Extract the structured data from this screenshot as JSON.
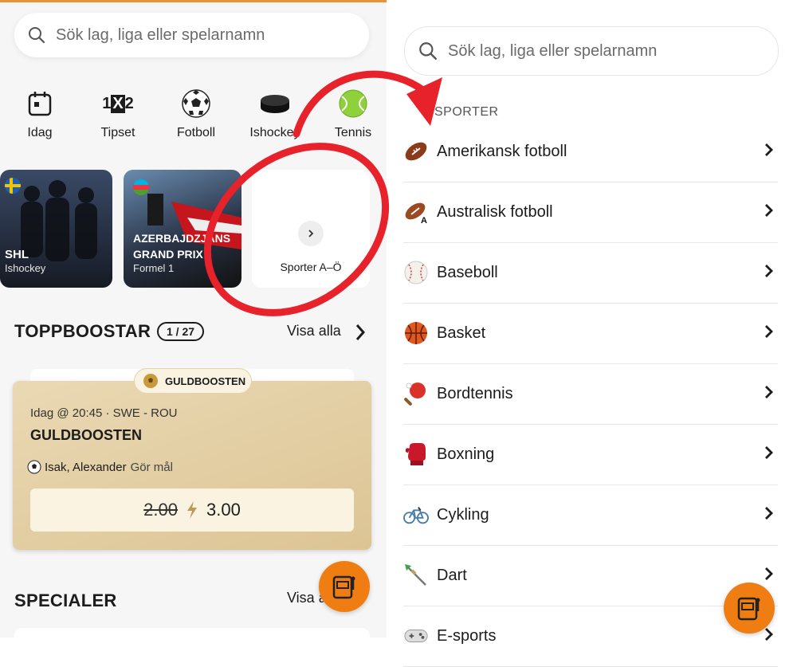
{
  "left": {
    "search_placeholder": "Sök lag, liga eller spelarnamn",
    "quick": [
      {
        "label": "Idag",
        "icon": "calendar-icon"
      },
      {
        "label": "Tipset",
        "icon": "1x2-icon"
      },
      {
        "label": "Fotboll",
        "icon": "soccer-ball-icon"
      },
      {
        "label": "Ishockey",
        "icon": "hockey-puck-icon"
      },
      {
        "label": "Tennis",
        "icon": "tennis-ball-icon"
      }
    ],
    "cards": [
      {
        "title": "SHL",
        "subtitle": "Ishockey",
        "flag": "sweden-flag-icon"
      },
      {
        "title": "AZERBAJDZJANS GRAND PRIX",
        "subtitle": "Formel 1",
        "flag": "azerbaijan-flag-icon"
      },
      {
        "label": "Sporter A–Ö"
      }
    ],
    "toppboostar": {
      "title": "TOPPBOOSTAR",
      "pager": "1 / 27",
      "view_all": "Visa alla"
    },
    "boost": {
      "badge": "GULDBOOSTEN",
      "meta": "Idag @ 20:45 · SWE - ROU",
      "title": "GULDBOOSTEN",
      "player": "Isak, Alexander",
      "market": "Gör mål",
      "old_odds": "2.00",
      "new_odds": "3.00"
    },
    "specialer": {
      "title": "SPECIALER",
      "view_all": "Visa alla"
    }
  },
  "right": {
    "search_placeholder": "Sök lag, liga eller spelarnamn",
    "section": "SPORTER",
    "sports": [
      {
        "label": "Amerikansk fotboll",
        "icon": "american-football-icon"
      },
      {
        "label": "Australisk fotboll",
        "icon": "australian-football-icon"
      },
      {
        "label": "Baseboll",
        "icon": "baseball-icon"
      },
      {
        "label": "Basket",
        "icon": "basketball-icon"
      },
      {
        "label": "Bordtennis",
        "icon": "table-tennis-icon"
      },
      {
        "label": "Boxning",
        "icon": "boxing-glove-icon"
      },
      {
        "label": "Cykling",
        "icon": "bicycle-icon"
      },
      {
        "label": "Dart",
        "icon": "dart-icon"
      },
      {
        "label": "E-sports",
        "icon": "gamepad-icon"
      }
    ]
  },
  "colors": {
    "accent": "#f07d12",
    "annotation": "#e8222a",
    "gold": "#dcc494"
  }
}
